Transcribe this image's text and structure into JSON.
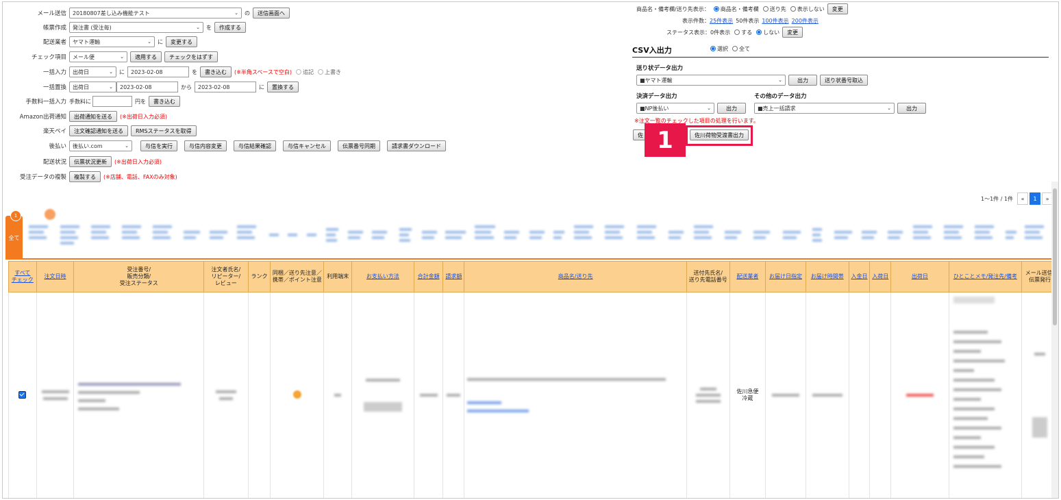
{
  "left": {
    "mail": {
      "label": "メール送信",
      "select": "20180807差し込み機能テスト",
      "connector": "の",
      "button": "送信画面へ"
    },
    "form": {
      "label": "帳票作成",
      "select": "発注書 (受注毎)",
      "connector": "を",
      "button": "作成する"
    },
    "carrier": {
      "label": "配送業者",
      "select": "ヤマト運輸",
      "connector": "に",
      "button": "変更する"
    },
    "check": {
      "label": "チェック項目",
      "select": "メール便",
      "button1": "適用する",
      "button2": "チェックをはずす"
    },
    "bulk": {
      "label": "一括入力",
      "select": "出荷日",
      "connector": "に",
      "date": "2023-02-08",
      "connector2": "を",
      "button": "書き込む",
      "note": "(※半角スペースで空白)",
      "radio1": "追記",
      "radio2": "上書き"
    },
    "replace": {
      "label": "一括置換",
      "select": "出荷日",
      "date1": "2023-02-08",
      "from": "から",
      "date2": "2023-02-08",
      "connector": "に",
      "button": "置換する"
    },
    "fee": {
      "label": "手数料一括入力",
      "prefix": "手数料に",
      "suffix": "円を",
      "button": "書き込む"
    },
    "amazon": {
      "label": "Amazon出荷通知",
      "button": "出荷通知を送る",
      "note": "(※出荷日入力必須)"
    },
    "rakuten": {
      "label": "楽天ペイ",
      "button1": "注文確認通知を送る",
      "button2": "RMSステータスを取得"
    },
    "atobarai": {
      "label": "後払い",
      "select": "後払い.com",
      "buttons": [
        "与信を実行",
        "与信内容変更",
        "与信結果確認",
        "与信キャンセル",
        "伝票番号同期",
        "請求書ダウンロード"
      ]
    },
    "delivery": {
      "label": "配送状況",
      "button": "伝票状況更新",
      "note": "(※出荷日入力必須)"
    },
    "dup": {
      "label": "受注データの複製",
      "button": "複製する",
      "note": "(※店舗、電話、FAXのみ対象)"
    }
  },
  "right": {
    "display": {
      "label": "商品名・備考欄/送り先表示：",
      "opt1": "商品名・備考欄",
      "opt2": "送り先",
      "opt3": "表示しない",
      "button": "変更"
    },
    "count": {
      "label": "表示件数：",
      "l25": "25件表示",
      "current": "50件表示",
      "l100": "100件表示",
      "l200": "200件表示"
    },
    "status": {
      "label": "ステータス表示：",
      "count": "0件表示",
      "opt1": "する",
      "opt2": "しない",
      "button": "変更"
    },
    "csv": {
      "title": "CSV入出力",
      "opt1": "選択",
      "opt2": "全て"
    },
    "slip": {
      "title": "送り状データ出力",
      "select": "■ヤマト運輸",
      "button1": "出力",
      "button2": "送り状番号取込"
    },
    "payment": {
      "title": "決済データ出力",
      "select": "■NP後払い",
      "button": "出力"
    },
    "other": {
      "title": "その他のデータ出力",
      "select": "■売上一括請求",
      "button": "出力"
    },
    "note": "※注文一覧のチェックした項目の処理を行います。",
    "sagawa_partial": "佐",
    "sagawa_button": "佐川荷物受渡書出力",
    "callout": "1"
  },
  "pager": {
    "info": "1〜1件 / 1件",
    "prev": "«",
    "page": "1",
    "next": "»"
  },
  "tabs": {
    "all": "全て",
    "badge": "1"
  },
  "table": {
    "headers": [
      "すべて\nチェック",
      "注文日時",
      "受注番号/\n販売分類/\n受注ステータス",
      "注文者氏名/\nリピーター/\nレビュー",
      "ランク",
      "同梱／送り先注意／\n携帯／ポイント注意",
      "利用端末",
      "お支払い方法",
      "合計金額",
      "請求額",
      "商品名/送り先",
      "送付先氏名/\n送り先電話番号",
      "配送業者",
      "お届け日指定",
      "お届け時間帯",
      "入金日",
      "入荷日",
      "出荷日",
      "ひとことメモ/発注先/備考",
      "メール送信/\n伝票発行"
    ],
    "row_carrier": "佐川急便\n冷蔵"
  }
}
